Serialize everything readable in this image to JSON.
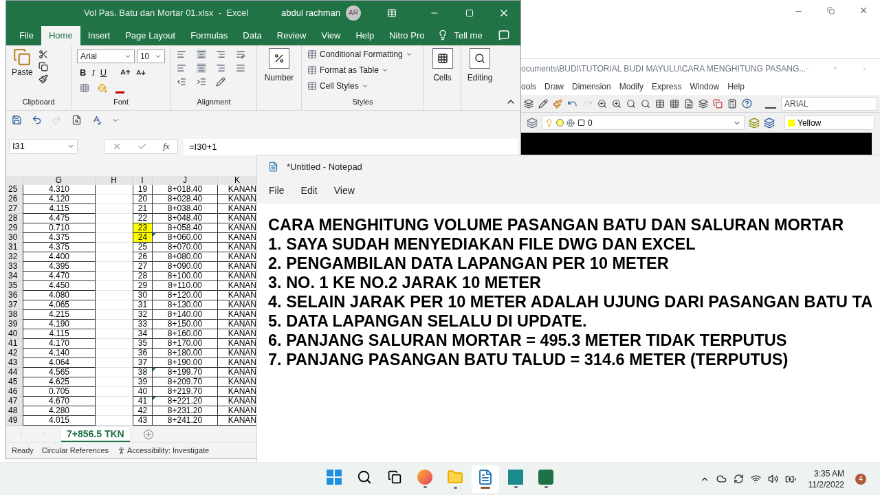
{
  "excel": {
    "title": "Vol Pas. Batu dan Mortar 01.xlsx  -  Excel",
    "user": "abdul rachman",
    "avatar": "AR",
    "tabs": [
      {
        "label": "File",
        "selected": false
      },
      {
        "label": "Home",
        "selected": true
      },
      {
        "label": "Insert",
        "selected": false
      },
      {
        "label": "Page Layout",
        "selected": false
      },
      {
        "label": "Formulas",
        "selected": false
      },
      {
        "label": "Data",
        "selected": false
      },
      {
        "label": "Review",
        "selected": false
      },
      {
        "label": "View",
        "selected": false
      },
      {
        "label": "Help",
        "selected": false
      },
      {
        "label": "Nitro Pro",
        "selected": false
      }
    ],
    "tell_me": "Tell me",
    "ribbon": {
      "paste": "Paste",
      "clipboard": "Clipboard",
      "font_name": "Arial",
      "font_size": "10",
      "bold": "B",
      "italic": "I",
      "underline": "U",
      "font": "Font",
      "alignment": "Alignment",
      "number": "Number",
      "styles_items": [
        "Conditional Formatting",
        "Format as Table",
        "Cell Styles"
      ],
      "styles": "Styles",
      "cells": "Cells",
      "editing": "Editing"
    },
    "name_box": "I31",
    "fx": "fx",
    "formula": "=I30+1",
    "columns": [
      "G",
      "H",
      "I",
      "J",
      "K"
    ],
    "rows": [
      {
        "row": "25",
        "g": "4.310",
        "i": "19",
        "j": "8+018.40",
        "k": "KANAN",
        "highlighted": false,
        "flag": false
      },
      {
        "row": "26",
        "g": "4.120",
        "i": "20",
        "j": "8+028.40",
        "k": "KANAN",
        "highlighted": false,
        "flag": false
      },
      {
        "row": "27",
        "g": "4.115",
        "i": "21",
        "j": "8+038.40",
        "k": "KANAN",
        "highlighted": false,
        "flag": false
      },
      {
        "row": "28",
        "g": "4.475",
        "i": "22",
        "j": "8+048.40",
        "k": "KANAN",
        "highlighted": false,
        "flag": false
      },
      {
        "row": "29",
        "g": "0.710",
        "i": "23",
        "j": "8+058.40",
        "k": "KANAN",
        "highlighted": true,
        "flag": false
      },
      {
        "row": "30",
        "g": "4.375",
        "i": "24",
        "j": "8+060.00",
        "k": "KANAN",
        "highlighted": true,
        "flag": true
      },
      {
        "row": "31",
        "g": "4.375",
        "i": "25",
        "j": "8+070.00",
        "k": "KANAN",
        "highlighted": false,
        "flag": false
      },
      {
        "row": "32",
        "g": "4.400",
        "i": "26",
        "j": "8+080.00",
        "k": "KANAN",
        "highlighted": false,
        "flag": false
      },
      {
        "row": "33",
        "g": "4.395",
        "i": "27",
        "j": "8+090.00",
        "k": "KANAN",
        "highlighted": false,
        "flag": false
      },
      {
        "row": "34",
        "g": "4.470",
        "i": "28",
        "j": "8+100.00",
        "k": "KANAN",
        "highlighted": false,
        "flag": false
      },
      {
        "row": "35",
        "g": "4.450",
        "i": "29",
        "j": "8+110.00",
        "k": "KANAN",
        "highlighted": false,
        "flag": false
      },
      {
        "row": "36",
        "g": "4.080",
        "i": "30",
        "j": "8+120.00",
        "k": "KANAN",
        "highlighted": false,
        "flag": false
      },
      {
        "row": "37",
        "g": "4.065",
        "i": "31",
        "j": "8+130.00",
        "k": "KANAN",
        "highlighted": false,
        "flag": false
      },
      {
        "row": "38",
        "g": "4.215",
        "i": "32",
        "j": "8+140.00",
        "k": "KANAN",
        "highlighted": false,
        "flag": false
      },
      {
        "row": "39",
        "g": "4.190",
        "i": "33",
        "j": "8+150.00",
        "k": "KANAN",
        "highlighted": false,
        "flag": false
      },
      {
        "row": "40",
        "g": "4.115",
        "i": "34",
        "j": "8+160.00",
        "k": "KANAN",
        "highlighted": false,
        "flag": false
      },
      {
        "row": "41",
        "g": "4.170",
        "i": "35",
        "j": "8+170.00",
        "k": "KANAN",
        "highlighted": false,
        "flag": false
      },
      {
        "row": "42",
        "g": "4.140",
        "i": "36",
        "j": "8+180.00",
        "k": "KANAN",
        "highlighted": false,
        "flag": false
      },
      {
        "row": "43",
        "g": "4.064",
        "i": "37",
        "j": "8+190.00",
        "k": "KANAN",
        "highlighted": false,
        "flag": false
      },
      {
        "row": "44",
        "g": "4.565",
        "i": "38",
        "j": "8+199.70",
        "k": "KANAN",
        "highlighted": false,
        "flag": true
      },
      {
        "row": "45",
        "g": "4.625",
        "i": "39",
        "j": "8+209.70",
        "k": "KANAN",
        "highlighted": false,
        "flag": false
      },
      {
        "row": "46",
        "g": "0.705",
        "i": "40",
        "j": "8+219.70",
        "k": "KANAN",
        "highlighted": false,
        "flag": false
      },
      {
        "row": "47",
        "g": "4.670",
        "i": "41",
        "j": "8+221.20",
        "k": "KANAN",
        "highlighted": false,
        "flag": true
      },
      {
        "row": "48",
        "g": "4.280",
        "i": "42",
        "j": "8+231.20",
        "k": "KANAN",
        "highlighted": false,
        "flag": false
      },
      {
        "row": "49",
        "g": "4.015",
        "i": "43",
        "j": "8+241.20",
        "k": "KANAN",
        "highlighted": false,
        "flag": false
      }
    ],
    "sheet_tab": "7+856.5 TKN",
    "status": [
      "Ready",
      "Circular References",
      "Accessibility: Investigate"
    ]
  },
  "autocad": {
    "title": "ocuments\\BUDI\\TUTORIAL BUDI MAYULU\\CARA MENGHITUNG PASANG...",
    "menu": [
      "ools",
      "Draw",
      "Dimension",
      "Modify",
      "Express",
      "Window",
      "Help"
    ],
    "text_style": "ARIAL",
    "layer": "0",
    "color": {
      "name": "Yellow",
      "color": "#ffff00"
    }
  },
  "notepad": {
    "title": "*Untitled - Notepad",
    "menu": [
      "File",
      "Edit",
      "View"
    ],
    "lines": [
      "CARA MENGHITUNG VOLUME PASANGAN BATU DAN SALURAN MORTAR",
      "1. SAYA SUDAH MENYEDIAKAN FILE DWG DAN EXCEL",
      "2. PENGAMBILAN DATA LAPANGAN PER 10 METER",
      "3. NO. 1 KE NO.2 JARAK 10 METER",
      "4. SELAIN JARAK PER 10 METER ADALAH UJUNG DARI PASANGAN BATU TA",
      "5. DATA LAPANGAN SELALU DI UPDATE.",
      "6. PANJANG SALURAN MORTAR = 495.3 METER TIDAK TERPUTUS",
      "7. PANJANG PASANGAN BATU TALUD = 314.6 METER (TERPUTUS)"
    ]
  },
  "taskbar": {
    "apps": [
      {
        "kind": "start",
        "selected": false
      },
      {
        "kind": "search",
        "selected": false
      },
      {
        "kind": "taskview",
        "selected": false
      },
      {
        "kind": "browser",
        "selected": false
      },
      {
        "kind": "folder",
        "selected": false
      },
      {
        "kind": "notepad",
        "selected": true
      },
      {
        "kind": "cad",
        "selected": false
      },
      {
        "kind": "excel",
        "selected": false
      }
    ],
    "time": "3:35 AM",
    "date": "11/2/2022",
    "notifications": "4"
  }
}
